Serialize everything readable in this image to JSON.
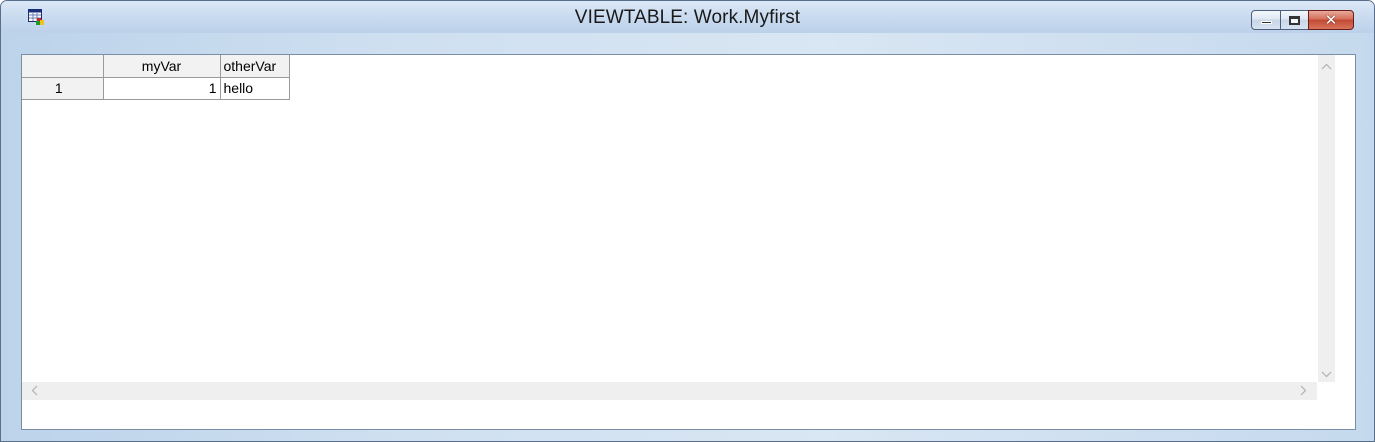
{
  "window": {
    "title": "VIEWTABLE: Work.Myfirst"
  },
  "icons": {
    "app": "viewtable-app-icon",
    "minimize": "minimize-icon",
    "maximize": "maximize-icon",
    "close": "close-icon",
    "scroll_up": "chevron-up-icon",
    "scroll_down": "chevron-down-icon",
    "scroll_left": "chevron-left-icon",
    "scroll_right": "chevron-right-icon"
  },
  "caption": {
    "close_glyph": "✕"
  },
  "table": {
    "columns": [
      "myVar",
      "otherVar"
    ],
    "rows": [
      {
        "row_number": "1",
        "myVar": "1",
        "otherVar": "hello"
      }
    ]
  },
  "colors": {
    "close_button": "#c24a33",
    "frame": "#c8daef",
    "grid_header": "#f2f2f2"
  }
}
